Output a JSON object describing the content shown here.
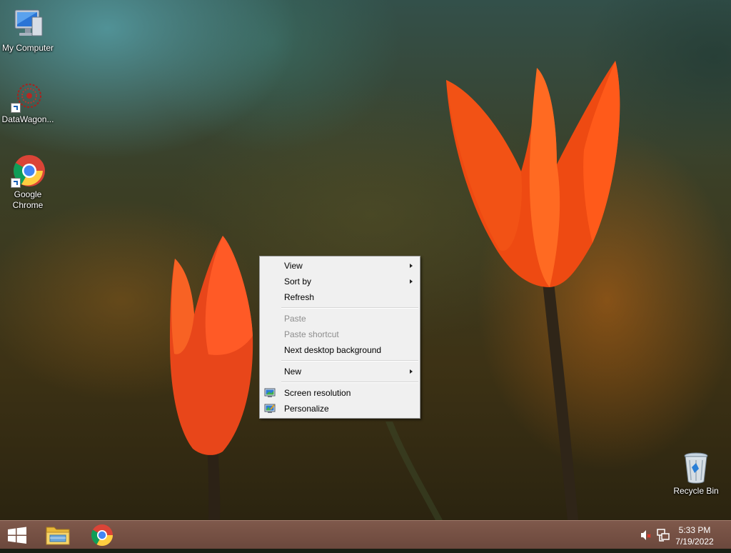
{
  "desktop": {
    "icons": [
      {
        "label": "My Computer",
        "icon": "computer-icon"
      },
      {
        "label": "DataWagon...",
        "icon": "datawagon-icon"
      },
      {
        "label": "Google Chrome",
        "icon": "chrome-icon"
      },
      {
        "label": "Recycle Bin",
        "icon": "recycle-bin-icon"
      }
    ]
  },
  "context_menu": {
    "items": [
      {
        "label": "View",
        "submenu": true,
        "enabled": true
      },
      {
        "label": "Sort by",
        "submenu": true,
        "enabled": true
      },
      {
        "label": "Refresh",
        "enabled": true
      },
      {
        "label": "Paste",
        "enabled": false
      },
      {
        "label": "Paste shortcut",
        "enabled": false
      },
      {
        "label": "Next desktop background",
        "enabled": true
      },
      {
        "label": "New",
        "submenu": true,
        "enabled": true
      },
      {
        "label": "Screen resolution",
        "icon": "display-icon",
        "enabled": true
      },
      {
        "label": "Personalize",
        "icon": "personalize-icon",
        "enabled": true
      }
    ]
  },
  "taskbar": {
    "pinned": [
      {
        "icon": "start-windows-icon"
      },
      {
        "icon": "file-explorer-icon"
      },
      {
        "icon": "chrome-icon"
      }
    ],
    "tray": {
      "time": "5:33 PM",
      "date": "7/19/2022",
      "icons": [
        "speaker-muted-icon",
        "network-icon"
      ]
    }
  },
  "colors": {
    "menu_background": "#f0f0f0",
    "menu_disabled_text": "#8d8d8d",
    "taskbar": "#7a5244"
  }
}
